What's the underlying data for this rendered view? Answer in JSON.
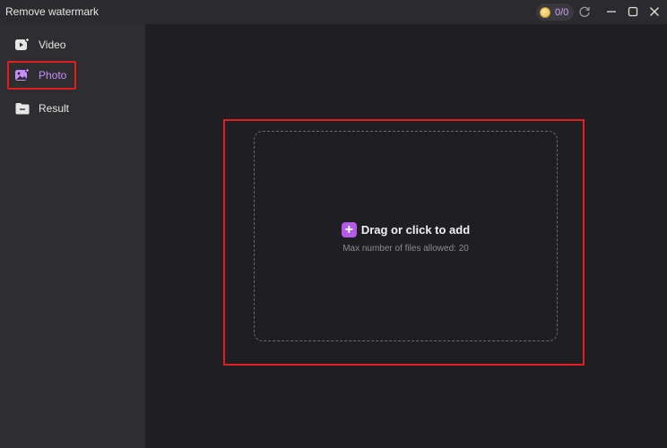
{
  "window": {
    "title": "Remove watermark",
    "credits": "0/0"
  },
  "icons": {
    "coin": "coin-icon",
    "refresh": "refresh-icon",
    "minimize": "minimize-icon",
    "maximize": "maximize-icon",
    "close": "close-icon",
    "video": "video-icon",
    "photo": "photo-icon",
    "result": "folder-icon",
    "add": "plus-icon"
  },
  "sidebar": {
    "items": [
      {
        "label": "Video",
        "active": false
      },
      {
        "label": "Photo",
        "active": true
      },
      {
        "label": "Result",
        "active": false
      }
    ]
  },
  "dropzone": {
    "plus": "+",
    "label": "Drag or click to add",
    "hint": "Max number of files allowed: 20"
  },
  "colors": {
    "accent": "#b45ae8",
    "active_label": "#c98cff",
    "highlight_border": "#e02020",
    "sidebar_bg": "#2e2e31",
    "main_bg": "#1f1f23"
  }
}
